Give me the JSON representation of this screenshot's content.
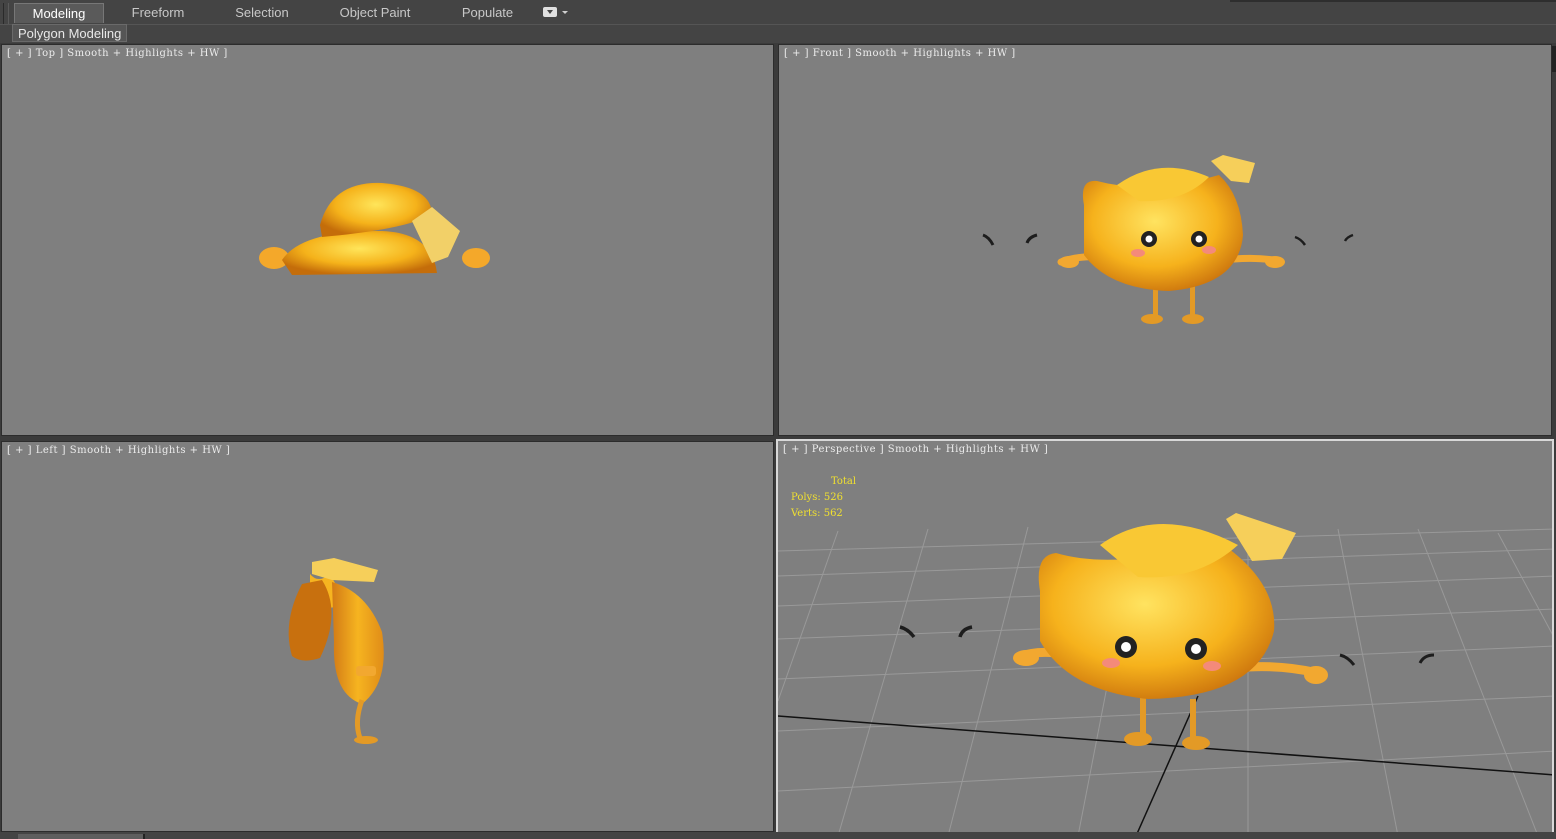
{
  "ribbon": {
    "tabs": [
      {
        "label": "Modeling",
        "active": true
      },
      {
        "label": "Freeform",
        "active": false
      },
      {
        "label": "Selection",
        "active": false
      },
      {
        "label": "Object Paint",
        "active": false
      },
      {
        "label": "Populate",
        "active": false
      }
    ],
    "extra_icon": "dropdown-options-icon"
  },
  "panel": {
    "label": "Polygon Modeling"
  },
  "viewports": {
    "top": {
      "label": "[ + ] Top ] Smooth + Highlights + HW ]"
    },
    "front": {
      "label": "[ + ] Front ] Smooth + Highlights + HW ]"
    },
    "left": {
      "label": "[ + ] Left ] Smooth + Highlights + HW ]"
    },
    "perspective": {
      "label": "[ + ] Perspective ] Smooth + Highlights + HW ]",
      "stats": {
        "title": "Total",
        "polys": "Polys: 526",
        "verts": "Verts: 562"
      }
    }
  },
  "colors": {
    "viewport_bg": "#7f7f7f",
    "ui_bg": "#444444",
    "stats_text": "#f0e030",
    "banana": "#f5b21a"
  }
}
